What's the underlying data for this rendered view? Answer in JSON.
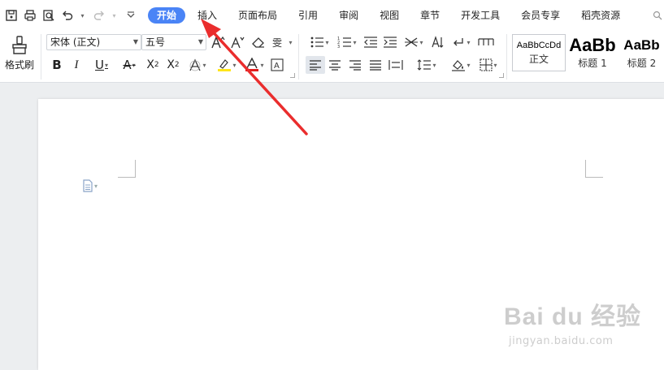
{
  "menubar": {
    "quick_access": [
      "save-icon",
      "print-icon",
      "print-preview-icon",
      "undo-icon",
      "redo-icon",
      "customize-icon"
    ],
    "tabs": [
      {
        "label": "开始",
        "active": true
      },
      {
        "label": "插入",
        "active": false
      },
      {
        "label": "页面布局",
        "active": false
      },
      {
        "label": "引用",
        "active": false
      },
      {
        "label": "审阅",
        "active": false
      },
      {
        "label": "视图",
        "active": false
      },
      {
        "label": "章节",
        "active": false
      },
      {
        "label": "开发工具",
        "active": false
      },
      {
        "label": "会员专享",
        "active": false
      },
      {
        "label": "稻壳资源",
        "active": false
      }
    ],
    "search_label": "查找"
  },
  "ribbon": {
    "format_painter_label": "格式刷",
    "font_name": "宋体 (正文)",
    "font_size": "五号",
    "styles": [
      {
        "sample": "AaBbCcDd",
        "label": "正文"
      },
      {
        "sample": "AaBb",
        "label": "标题 1"
      },
      {
        "sample": "AaBb",
        "label": "标题 2"
      }
    ]
  },
  "watermark": {
    "main": "Bai du 经验",
    "sub": "jingyan.baidu.com"
  },
  "colors": {
    "accent": "#4a84f6",
    "arrow": "#ea2d2d",
    "highlight": "#ffe51a",
    "font_color": "#e11c1c"
  }
}
